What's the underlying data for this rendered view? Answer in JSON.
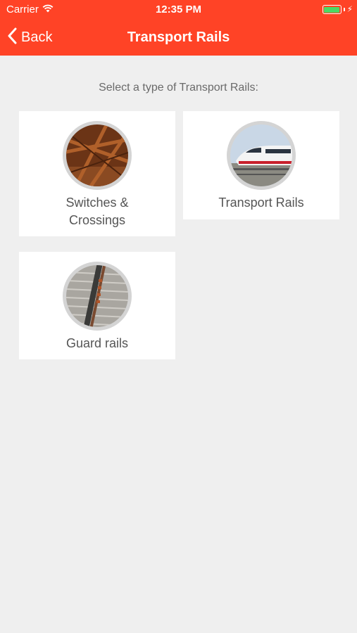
{
  "status_bar": {
    "carrier": "Carrier",
    "time": "12:35 PM",
    "battery_color": "#4cd964"
  },
  "nav": {
    "back_label": "Back",
    "title": "Transport Rails",
    "header_color": "#ff4326"
  },
  "prompt": "Select a type of Transport Rails:",
  "categories": [
    {
      "label": "Switches &\nCrossings",
      "icon": "rail-switch-icon"
    },
    {
      "label": "Transport Rails",
      "icon": "train-icon"
    },
    {
      "label": "Guard rails",
      "icon": "guard-rail-icon"
    }
  ]
}
